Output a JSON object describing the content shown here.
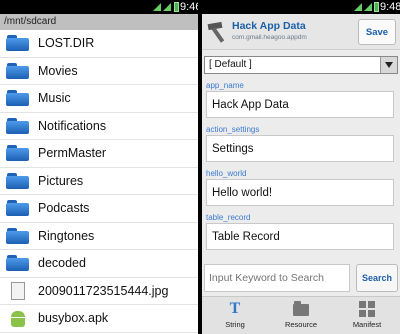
{
  "left": {
    "statusbar": {
      "time": "9:46"
    },
    "path": "/mnt/sdcard",
    "files": [
      {
        "name": "LOST.DIR",
        "icon": "folder-icon"
      },
      {
        "name": "Movies",
        "icon": "folder-icon"
      },
      {
        "name": "Music",
        "icon": "folder-icon"
      },
      {
        "name": "Notifications",
        "icon": "folder-icon"
      },
      {
        "name": "PermMaster",
        "icon": "folder-icon"
      },
      {
        "name": "Pictures",
        "icon": "folder-icon"
      },
      {
        "name": "Podcasts",
        "icon": "folder-icon"
      },
      {
        "name": "Ringtones",
        "icon": "folder-icon"
      },
      {
        "name": "decoded",
        "icon": "folder-icon"
      },
      {
        "name": "2009011723515444.jpg",
        "icon": "file-icon"
      },
      {
        "name": "busybox.apk",
        "icon": "android-icon"
      }
    ]
  },
  "right": {
    "statusbar": {
      "time": "9:48"
    },
    "app_title": "Hack App Data",
    "app_package": "com.gmail.heagoo.appdm",
    "save_label": "Save",
    "select_value": "[ Default ]",
    "fields": [
      {
        "label": "app_name",
        "value": "Hack App Data"
      },
      {
        "label": "action_settings",
        "value": "Settings"
      },
      {
        "label": "hello_world",
        "value": "Hello world!"
      },
      {
        "label": "table_record",
        "value": "Table Record"
      }
    ],
    "search_placeholder": "Input Keyword to Search",
    "search_label": "Search",
    "tabs": [
      {
        "label": "String",
        "icon": "text-icon"
      },
      {
        "label": "Resource",
        "icon": "folder-icon"
      },
      {
        "label": "Manifest",
        "icon": "grid-icon"
      }
    ]
  },
  "colors": {
    "accent": "#1b5fa8",
    "label_blue": "#3b7ad1",
    "status_bar": "#000000"
  }
}
